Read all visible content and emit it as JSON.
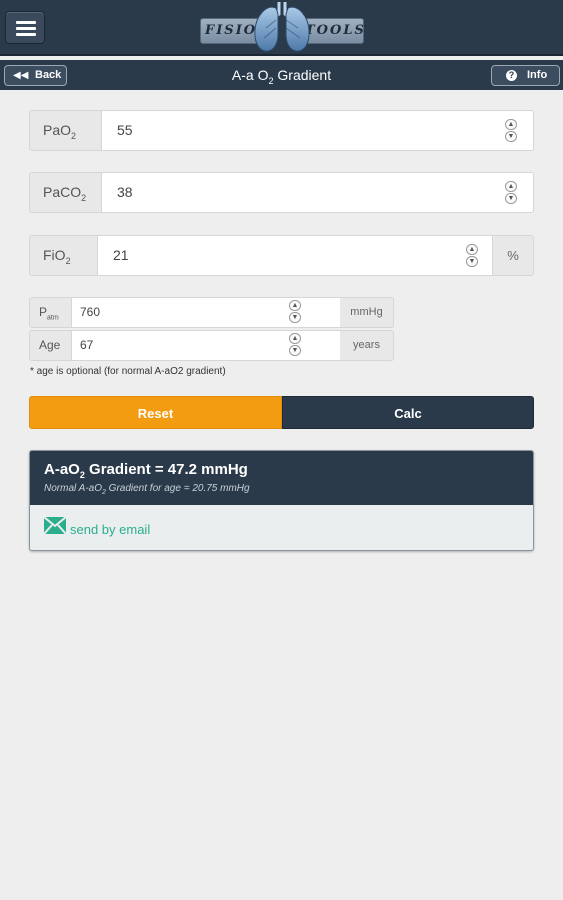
{
  "header": {
    "logo_left": "FISIO",
    "logo_right": "TOOLS"
  },
  "nav": {
    "back_label": "Back",
    "title_pre": "A-a O",
    "title_sub": "2",
    "title_post": " Gradient",
    "info_label": "Info",
    "info_glyph": "?"
  },
  "fields": {
    "pao2": {
      "label": "PaO",
      "label_sub": "2",
      "value": "55"
    },
    "paco2": {
      "label": "PaCO",
      "label_sub": "2",
      "value": "38"
    },
    "fio2": {
      "label": "FiO",
      "label_sub": "2",
      "value": "21",
      "suffix": "%"
    },
    "patm": {
      "label": "P",
      "label_sub": "atm",
      "value": "760",
      "suffix": "mmHg"
    },
    "age": {
      "label": "Age",
      "value": "67",
      "suffix": "years"
    }
  },
  "note": "* age is optional (for normal A-aO2 gradient)",
  "buttons": {
    "reset": "Reset",
    "calc": "Calc"
  },
  "result": {
    "title_pre": "A-aO",
    "title_sub": "2",
    "title_post": " Gradient = 47.2 mmHg",
    "subtitle_pre": "Normal A-aO",
    "subtitle_sub": "2",
    "subtitle_post": " Gradient for age = 20.75 mmHg",
    "email_label": "send by email"
  },
  "colors": {
    "navbar": "#2b3a4b",
    "reset": "#f39c12",
    "calc": "#2b3a4b",
    "email": "#2aae8e"
  }
}
